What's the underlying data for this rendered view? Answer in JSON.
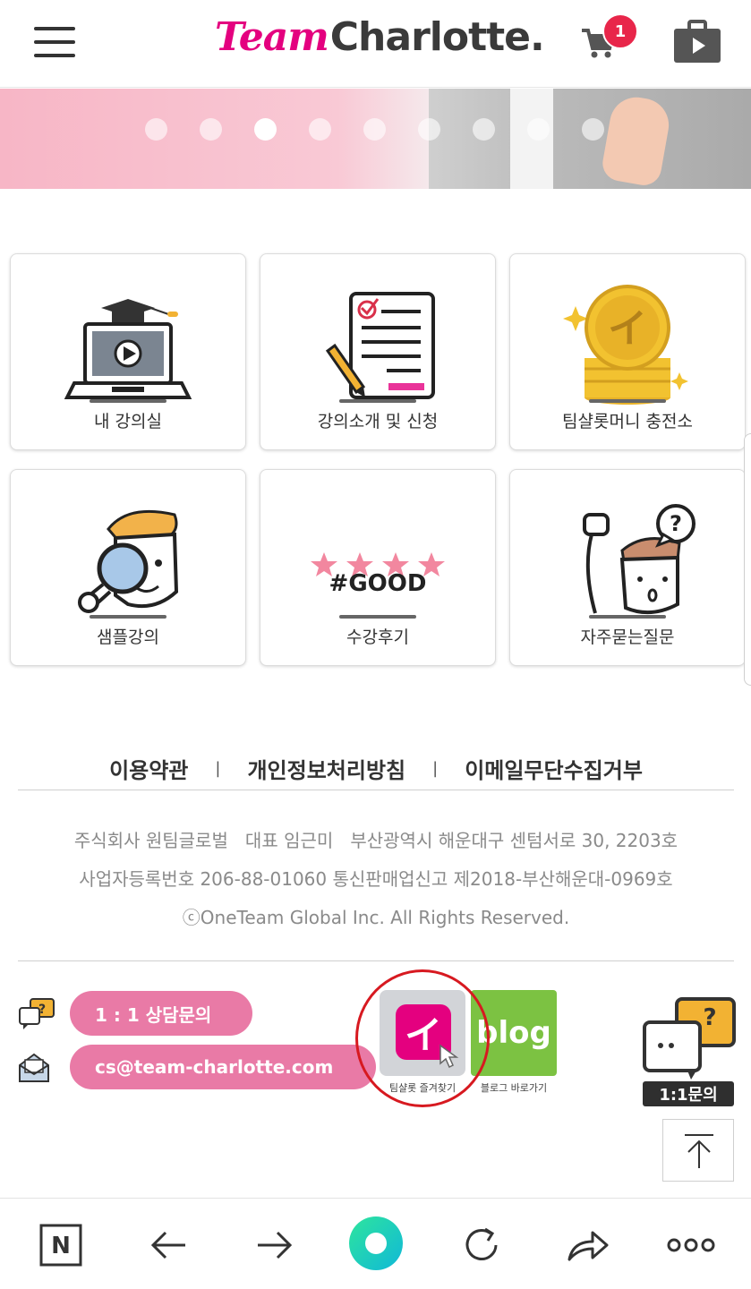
{
  "header": {
    "logo_team": "Team",
    "logo_charlotte": "Charlotte",
    "logo_dot": ".",
    "cart_count": "1"
  },
  "banner": {
    "slide_count": 9,
    "active_slide": 3
  },
  "menu": {
    "items": [
      {
        "label": "내 강의실",
        "icon": "laptop-graduation-icon"
      },
      {
        "label": "강의소개 및 신청",
        "icon": "application-document-icon"
      },
      {
        "label": "팀샬롯머니 충전소",
        "icon": "coin-stack-icon"
      },
      {
        "label": "샘플강의",
        "icon": "magnifier-character-icon"
      },
      {
        "label": "수강후기",
        "icon": "four-stars-icon",
        "badge": "#GOOD"
      },
      {
        "label": "자주묻는질문",
        "icon": "question-character-icon"
      }
    ]
  },
  "footer": {
    "links": [
      "이용약관",
      "개인정보처리방침",
      "이메일무단수집거부"
    ],
    "separator": "|",
    "company_line1": "주식회사 원팀글로벌   대표 임근미   부산광역시 해운대구 센텀서로 30, 2203호",
    "company_line2": "사업자등록번호 206-88-01060 통신판매업신고 제2018-부산해운대-0969호",
    "copyright": "ⓒOneTeam Global Inc. All Rights Reserved."
  },
  "contact": {
    "consult_label": "1 : 1 상담문의",
    "email": "cs@team-charlotte.com",
    "favorite_glyph": "イ",
    "favorite_label": "팀샬롯 즐겨찾기",
    "blog_text": "blog",
    "blog_label": "블로그 바로가기",
    "qa_mark": "?",
    "qa_label": "1:1문의"
  },
  "colors": {
    "brand_pink": "#e4007f",
    "pill_pink": "#e97aa6",
    "blog_green": "#7cc242",
    "badge_red": "#e8264a",
    "highlight_circle": "#d71920"
  },
  "bottom_bar": {
    "items": [
      "naver-icon",
      "back-arrow-icon",
      "forward-arrow-icon",
      "home-circle-icon",
      "refresh-icon",
      "share-icon",
      "more-icon"
    ]
  }
}
